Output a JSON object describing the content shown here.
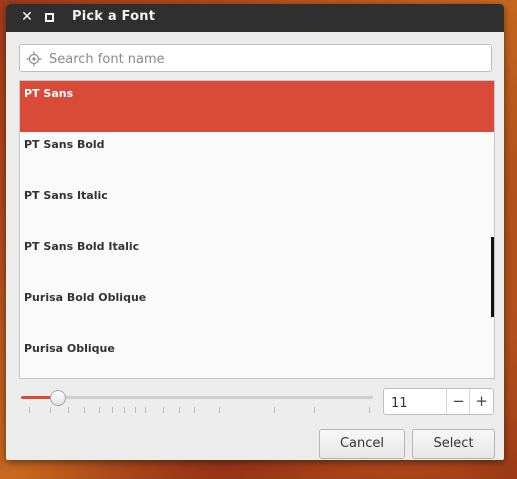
{
  "window": {
    "title": "Pick a Font",
    "close_glyph": "✕",
    "close_icon": "close-icon",
    "maximize_icon": "maximize-icon"
  },
  "search": {
    "placeholder": "Search font name",
    "value": "",
    "icon": "locate-icon"
  },
  "fonts": {
    "items": [
      {
        "label": "PT Sans",
        "selected": true
      },
      {
        "label": "PT Sans Bold",
        "selected": false
      },
      {
        "label": "PT Sans Italic",
        "selected": false
      },
      {
        "label": "PT Sans Bold Italic",
        "selected": false
      },
      {
        "label": "Purisa Bold Oblique",
        "selected": false
      },
      {
        "label": "Purisa Oblique",
        "selected": false
      }
    ]
  },
  "size": {
    "value": "11",
    "minus_label": "−",
    "plus_label": "+"
  },
  "buttons": {
    "cancel": "Cancel",
    "select": "Select"
  },
  "colors": {
    "accent": "#d94a38",
    "titlebar": "#2f2f2f"
  }
}
